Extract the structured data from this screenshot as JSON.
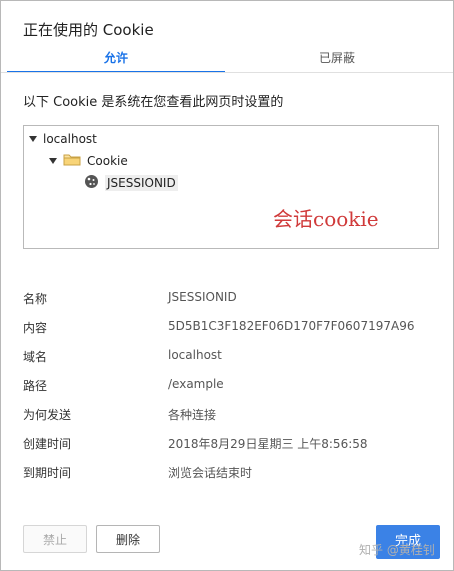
{
  "dialog": {
    "title": "正在使用的 Cookie",
    "tabs": [
      {
        "label": "允许"
      },
      {
        "label": "已屏蔽"
      }
    ],
    "description": "以下 Cookie 是系统在您查看此网页时设置的",
    "tree": {
      "host": "localhost",
      "folder": "Cookie",
      "item": "JSESSIONID"
    },
    "annotation": "会话cookie",
    "details": [
      {
        "label": "名称",
        "value": "JSESSIONID"
      },
      {
        "label": "内容",
        "value": "5D5B1C3F182EF06D170F7F0607197A96"
      },
      {
        "label": "域名",
        "value": "localhost"
      },
      {
        "label": "路径",
        "value": "/example"
      },
      {
        "label": "为何发送",
        "value": "各种连接"
      },
      {
        "label": "创建时间",
        "value": "2018年8月29日星期三 上午8:56:58"
      },
      {
        "label": "到期时间",
        "value": "浏览会话结束时"
      }
    ],
    "buttons": {
      "block": "禁止",
      "delete": "删除",
      "done": "完成"
    },
    "watermark": "知乎 @黄桂钊"
  },
  "colors": {
    "accent": "#1a73e8",
    "done_button": "#3b82e6",
    "annotation": "#d03a3a"
  }
}
